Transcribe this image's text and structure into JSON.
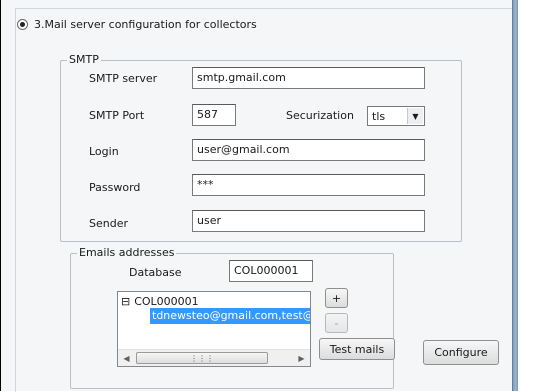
{
  "section": {
    "radio_label": "3.Mail server configuration for collectors",
    "radio_checked": true
  },
  "smtp": {
    "legend": "SMTP",
    "server_label": "SMTP server",
    "server_value": "smtp.gmail.com",
    "port_label": "SMTP Port",
    "port_value": "587",
    "securization_label": "Securization",
    "securization_value": "tls",
    "login_label": "Login",
    "login_value": "user@gmail.com",
    "password_label": "Password",
    "password_value": "***",
    "sender_label": "Sender",
    "sender_value": "user"
  },
  "emails": {
    "legend": "Emails addresses",
    "database_label": "Database",
    "database_value": "COL000001",
    "tree": {
      "expander": "⊟",
      "root": "COL000001",
      "child": "tdnewsteo@gmail.com,test@news"
    },
    "add_label": "+",
    "remove_label": "-",
    "test_label": "Test mails"
  },
  "configure_label": "Configure",
  "icons": {
    "dropdown": "chevron-down-icon",
    "scroll_left": "arrow-left-icon",
    "scroll_right": "arrow-right-icon",
    "grip": "grip-icon"
  }
}
